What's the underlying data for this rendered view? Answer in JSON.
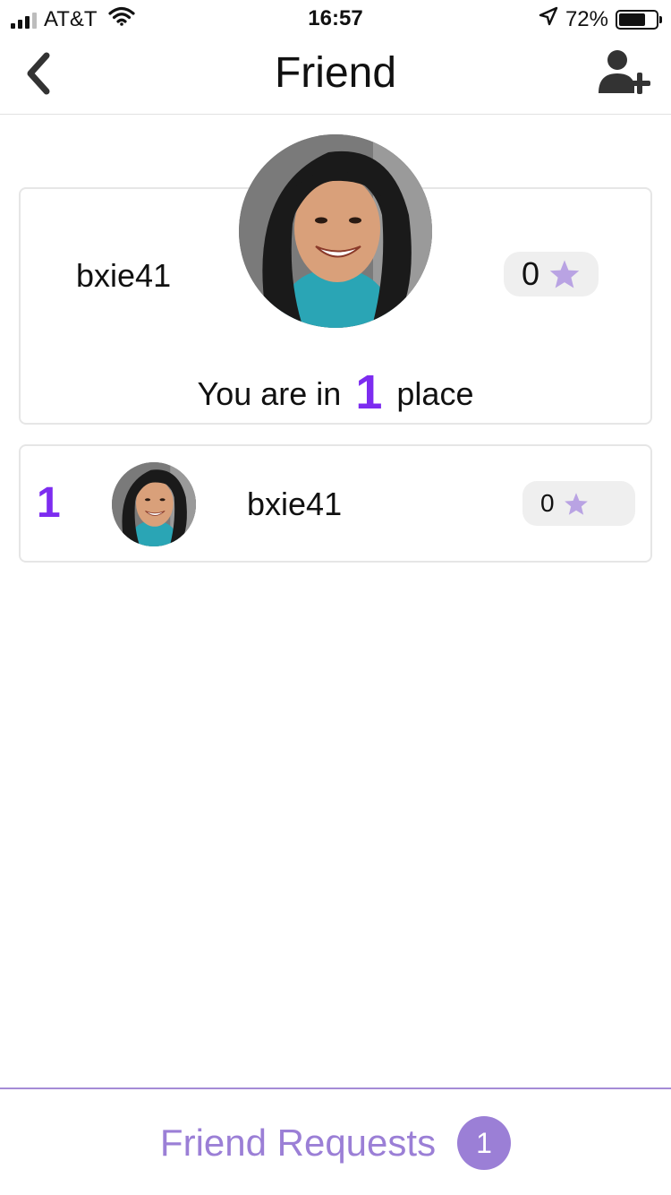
{
  "status_bar": {
    "carrier": "AT&T",
    "time": "16:57",
    "battery_percent": "72%",
    "battery_level": 0.72,
    "icons": [
      "signal-icon",
      "wifi-icon",
      "location-arrow-icon",
      "battery-icon"
    ]
  },
  "nav": {
    "title": "Friend",
    "back_icon": "chevron-left-icon",
    "add_icon": "add-user-icon"
  },
  "profile": {
    "username": "bxie41",
    "score": "0",
    "place_prefix": "You are in",
    "place_number": "1",
    "place_suffix": "place",
    "avatar": "user-avatar"
  },
  "leaderboard": [
    {
      "rank": "1",
      "username": "bxie41",
      "score": "0"
    }
  ],
  "bottom": {
    "friend_requests_label": "Friend Requests",
    "friend_requests_count": "1"
  },
  "colors": {
    "accent_purple": "#7d2cf0",
    "soft_purple": "#9b7fd6",
    "star_lavender": "#b9a3e3",
    "pill_gray": "#efefef"
  }
}
